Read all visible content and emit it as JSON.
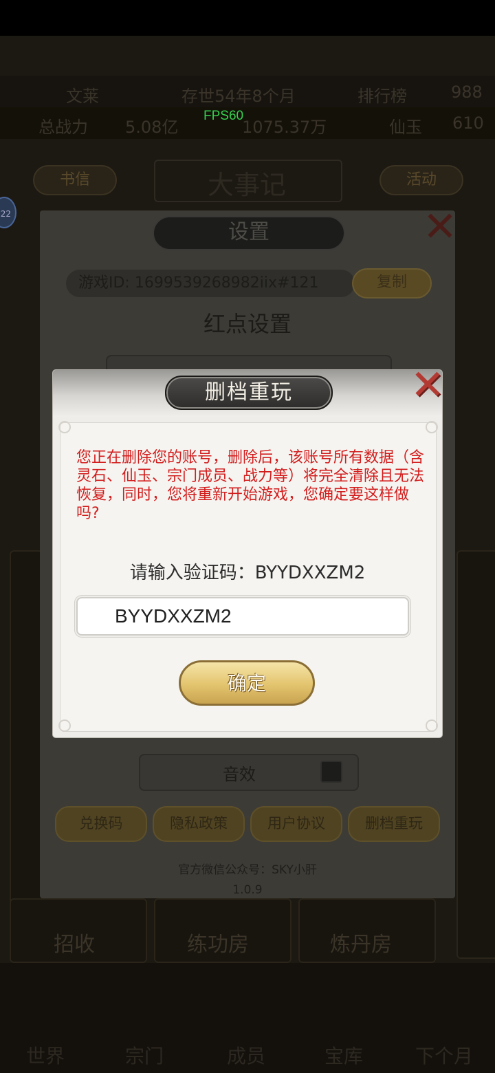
{
  "hud": {
    "player_name": "文莱",
    "survival_time": "存世54年8个月",
    "ranking": "排行榜",
    "top_right_value": "988",
    "power_label": "总战力",
    "power_value": "5.08亿",
    "spirit_stone": "1075.37万",
    "jade_label": "仙玉",
    "jade_value": "610",
    "fps": "FPS60",
    "avatar_badge": "22"
  },
  "background": {
    "left_pill": "书信",
    "right_pill": "活动",
    "title": "大事记",
    "tiles": [
      "招收",
      "练功房",
      "炼丹房"
    ],
    "nav": [
      "世界",
      "宗门",
      "成员",
      "宝库",
      "下个月"
    ]
  },
  "settings": {
    "title": "设置",
    "game_id": "游戏ID: 1699539268982iix#121",
    "copy_button": "复制",
    "red_dot_heading": "红点设置",
    "sound_label": "音效",
    "buttons": [
      "兑换码",
      "隐私政策",
      "用户协议",
      "删档重玩"
    ],
    "wechat": "官方微信公众号：SKY小肝",
    "version": "1.0.9"
  },
  "dialog": {
    "title": "删档重玩",
    "warning": "您正在删除您的账号，删除后，该账号所有数据（含灵石、仙玉、宗门成员、战力等）将完全清除且无法恢复，同时，您将重新开始游戏，您确定要这样做吗?",
    "captcha_label": "请输入验证码：BYYDXXZM2",
    "input_value": "BYYDXXZM2",
    "confirm_button": "确定"
  },
  "colors": {
    "warning_red": "#d21d1d",
    "gold_button": "#e3c46e",
    "close_red": "#b33a33",
    "fps_green": "#35d14e"
  }
}
